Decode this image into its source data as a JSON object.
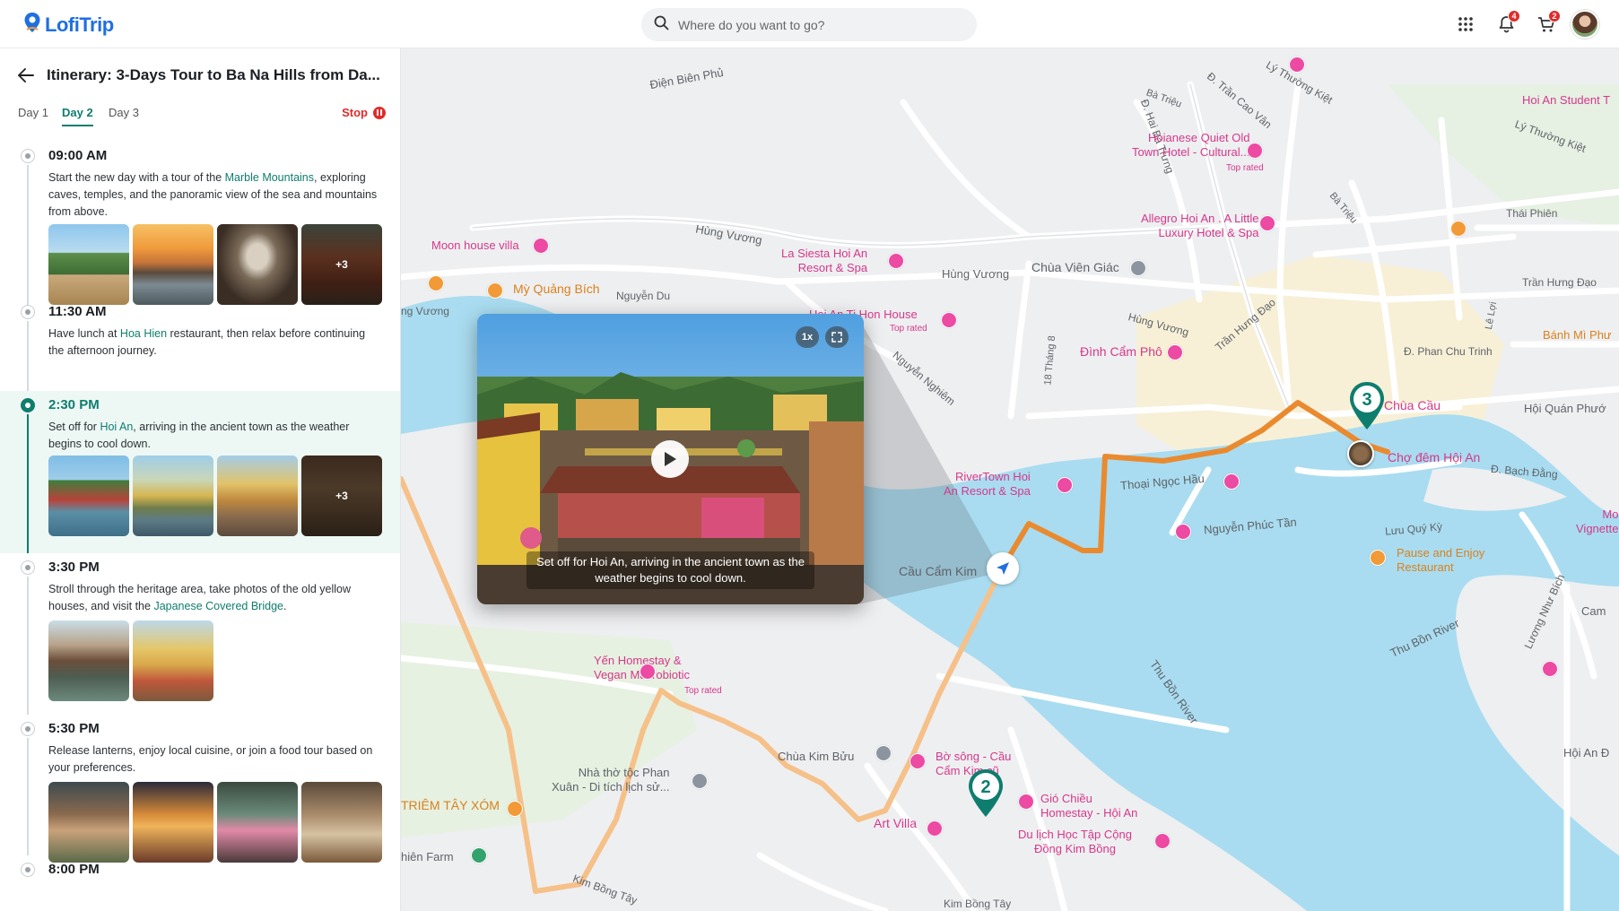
{
  "app": {
    "name": "LofiTrip"
  },
  "search": {
    "placeholder": "Where do you want to go?"
  },
  "header": {
    "notifications_count": "4",
    "cart_count": "2"
  },
  "itinerary": {
    "title": "Itinerary: 3-Days Tour to Ba Na Hills from Da...",
    "tabs": [
      "Day 1",
      "Day 2",
      "Day 3"
    ],
    "active_tab": "Day 2",
    "stop_label": "Stop",
    "stops": [
      {
        "time": "09:00 AM",
        "desc_pre": "Start the new day with a tour of the ",
        "desc_hl": "Marble Mountains",
        "desc_post": ", exploring caves, temples, and the panoramic view of the sea and mountains from above.",
        "more": "+3"
      },
      {
        "time": "11:30 AM",
        "desc_pre": "Have lunch at ",
        "desc_hl": "Hoa Hien",
        "desc_post": " restaurant, then relax before continuing the afternoon journey."
      },
      {
        "time": "2:30 PM",
        "desc_pre": "Set off for ",
        "desc_hl": "Hoi An",
        "desc_post": ", arriving in the ancient town as the weather begins to cool down.",
        "more": "+3"
      },
      {
        "time": "3:30 PM",
        "desc_pre": "Stroll through the heritage area, take photos of the old yellow houses, and visit the ",
        "desc_hl": "Japanese Covered Bridge",
        "desc_post": "."
      },
      {
        "time": "5:30 PM",
        "desc_pre": "Release lanterns, enjoy local cuisine, or join a food tour based on your preferences.",
        "desc_hl": "",
        "desc_post": ""
      },
      {
        "time": "8:00 PM",
        "desc_pre": "",
        "desc_hl": "",
        "desc_post": ""
      }
    ]
  },
  "popup": {
    "speed": "1x",
    "caption": "Set off for Hoi An, arriving in the ancient town as the weather begins to cool down."
  },
  "map": {
    "pins": [
      "2",
      "3"
    ],
    "labels": {
      "dien_bien_phu": "Điện Biên Phủ",
      "ba_trieu_1": "Bà Triệu",
      "ly_thuong_kiet_1": "Lý Thường Kiệt",
      "hai_ba_trung": "Đ. Hai Bà Trưng",
      "tran_cao_van": "Đ. Trần Cao Vân",
      "hoi_an_student": "Hoi An Student T",
      "ly_thuong_kiet_2": "Lý Thường Kiệt",
      "hoianese": "Hoianese Quiet Old\nTown Hotel - Cultural...",
      "top_rated": "Top rated",
      "ba_trieu_2": "Bà Triệu",
      "thai_phien": "Thái Phiên",
      "allegro": "Allegro Hoi An . A Little\nLuxury Hotel & Spa",
      "hung_vuong_1": "Hùng Vương",
      "moon_house": "Moon house villa",
      "la_siesta": "La Siesta Hoi An\nResort & Spa",
      "hung_vuong_2": "Hùng Vương",
      "chua_vien_giac": "Chùa Viên Giác",
      "tran_hung_dao_1": "Trần Hưng Đạo",
      "tran_hung_dao_2": "Trần Hưng Đạo",
      "my_quang_bich": "Mỳ Quảng Bích",
      "nguyen_du": "Nguyễn Du",
      "ng_vuong": "ng Vương",
      "hoi_an_ti_hon": "Hoi An Ti Hon House",
      "top_rated_2": "Top rated",
      "hung_vuong_3": "Hùng Vương",
      "le_loi": "Lê Lợi",
      "banh_mi": "Bánh Mì Phư",
      "nguyen_nghiem": "Nguyễn Nghiêm",
      "thang8": "18 Tháng 8",
      "dinh_cam_pho": "Đình Cẩm Phô",
      "phan_chu_trinh": "Đ. Phan Chu Trinh",
      "chua_cau": "Chùa Cầu",
      "hoi_quan": "Hội Quán Phướ",
      "cho_dem": "Chợ đêm Hội An",
      "bach_dang": "Đ. Bạch Đằng",
      "rivertown": "RiverTown Hoi\nAn Resort & Spa",
      "thoai_ngoc_hau": "Thoại Ngọc Hầu",
      "nguyen_phuc_tan": "Nguyễn Phúc Tần",
      "luu_quy_ky": "Lưu Quý Kỳ",
      "pause_enjoy": "Pause and Enjoy\nRestaurant",
      "vignette": "Mo\nVignette",
      "cau_cam_kim": "Cầu Cẩm Kim",
      "yen_homestay": "Yến Homestay &\nVegan Macrobiotic",
      "top_rated_3": "Top rated",
      "thu_bon_1": "Thu Bồn River",
      "thu_bon_2": "Thu Bồn River",
      "luong_nhu_bich": "Lương Như Bích",
      "cam": "Cam",
      "hoi_an_d": "Hội An Đ",
      "nha_tho": "Nhà thờ tộc Phan\nXuân - Di tích lịch sử...",
      "chua_kim_buu": "Chùa Kim Bửu",
      "bo_song": "Bờ sông - Cầu\nCẩm Kim cũ",
      "giothieu": "Gió Chiều\nHomestay - Hội An",
      "tram_tay_xom": "TRIÊM TÂY XÓM",
      "art_villa": "Art Villa",
      "du_lich": "Du lịch Học Tập Cộng\nĐồng Kim Bồng",
      "hien_farm": "hiên Farm",
      "kim_bong_1": "Kim Bồng Tây",
      "kim_bong_2": "Kim Bồng Tây"
    }
  },
  "colors": {
    "accent": "#0f7d6e",
    "brand": "#1f6fe0",
    "route_active": "#ea8a2f",
    "route_past": "#f6c089",
    "stop": "#e02b2b",
    "water": "#a9dcf0",
    "poi_pink": "#d6388a"
  },
  "icons": {
    "logo": "map-pin-icon",
    "search": "search-icon",
    "apps": "grid-icon",
    "bell": "bell-icon",
    "cart": "cart-icon",
    "back": "arrow-left-icon",
    "stop": "pause-icon",
    "play": "play-icon",
    "expand": "expand-icon",
    "nav": "navigation-arrow-icon"
  }
}
